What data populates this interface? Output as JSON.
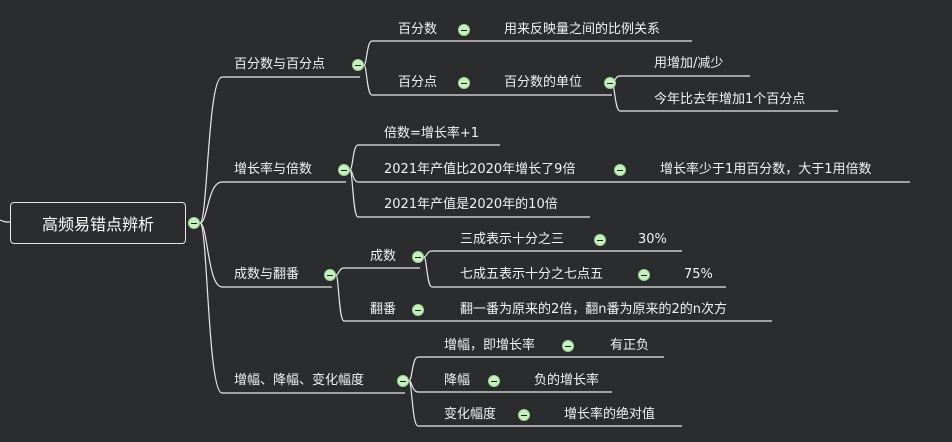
{
  "root": {
    "label": "高频易错点辨析"
  },
  "branches": [
    {
      "label": "百分数与百分点"
    },
    {
      "label": "增长率与倍数"
    },
    {
      "label": "成数与翻番"
    },
    {
      "label": "增幅、降幅、变化幅度"
    }
  ],
  "nodes": {
    "percent": "百分数",
    "percent_def": "用来反映量之间的比例关系",
    "point": "百分点",
    "point_unit": "百分数的单位",
    "point_use": "用增加/减少",
    "point_example": "今年比去年增加1个百分点",
    "multiple_formula": "倍数=增长率+1",
    "growth_example": "2021年产值比2020年增长了9倍",
    "growth_note": "增长率少于1用百分数，大于1用倍数",
    "multiple_example": "2021年产值是2020年的10倍",
    "chengshu": "成数",
    "san_cheng": "三成表示十分之三",
    "san_cheng_value": "30%",
    "qi_cheng_wu": "七成五表示十分之七点五",
    "qi_cheng_wu_value": "75%",
    "fanfan": "翻番",
    "fanfan_def": "翻一番为原来的2倍，翻n番为原来的2的n次方",
    "zengfu": "增幅，即增长率",
    "zengfu_sign": "有正负",
    "jiangfu": "降幅",
    "jiangfu_def": "负的增长率",
    "bianhua": "变化幅度",
    "bianhua_def": "增长率的绝对值"
  },
  "colors": {
    "background": "#2b2c2e",
    "line": "#e8e8e8",
    "toggle": "#c6f0c0"
  }
}
